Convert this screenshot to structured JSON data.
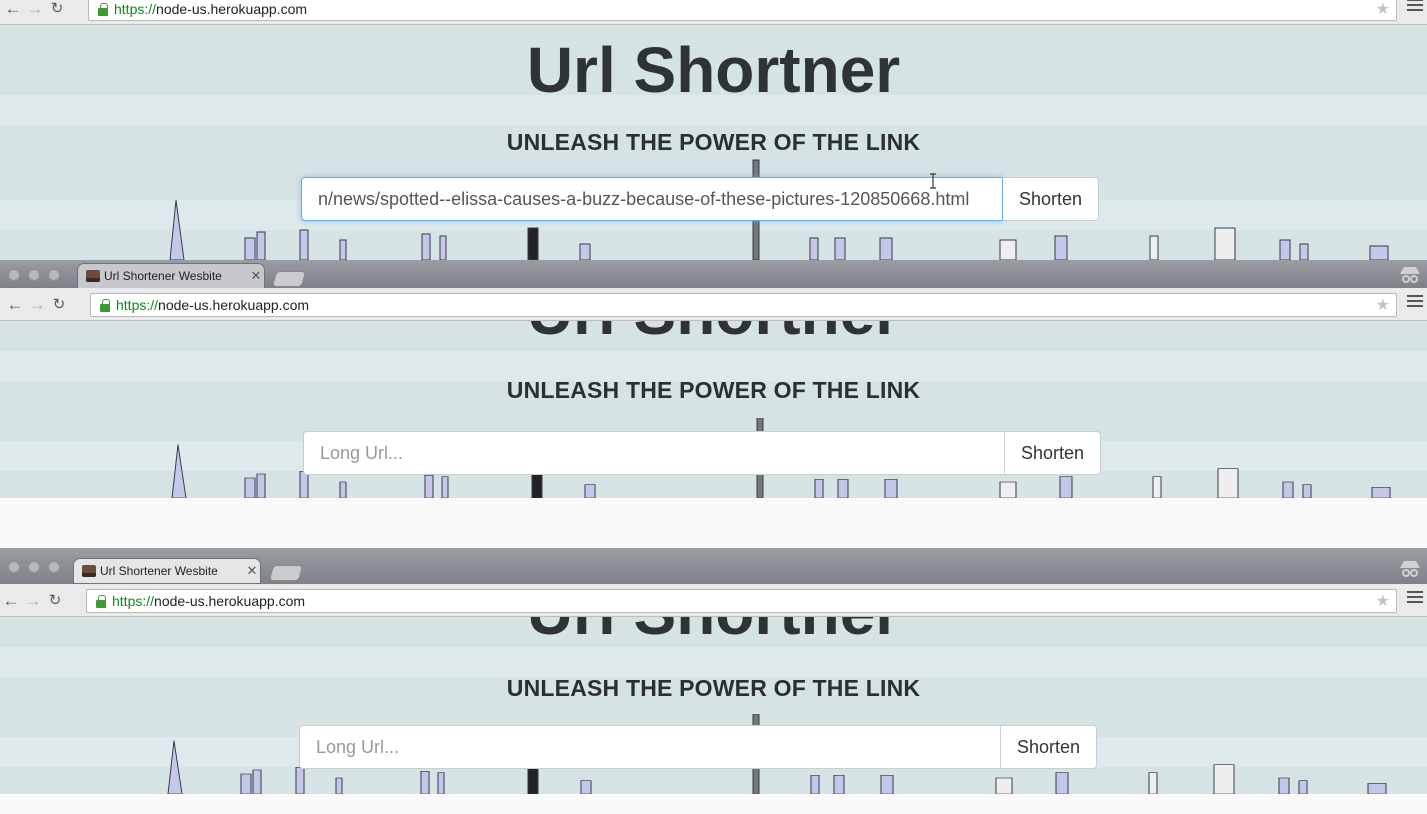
{
  "windows": [
    {
      "id": "top",
      "show_tabbar": false,
      "url_scheme": "https://",
      "url_host": "node-us.herokuapp.com",
      "title": "Url Shortner",
      "subtitle": "UNLEASH THE POWER OF THE LINK",
      "input_value": "n/news/spotted--elissa-causes-a-buzz-because-of-these-pictures-120850668.html",
      "button_label": "Shorten"
    },
    {
      "id": "middle",
      "show_tabbar": true,
      "tab_title": "Url Shortener Wesbite",
      "url_scheme": "https://",
      "url_host": "node-us.herokuapp.com",
      "title": "Url Shortner",
      "subtitle": "UNLEASH THE POWER OF THE LINK",
      "input_placeholder": "Long Url...",
      "button_label": "Shorten"
    },
    {
      "id": "bottom",
      "show_tabbar": true,
      "tab_title": "Url Shortener Wesbite",
      "url_scheme": "https://",
      "url_host": "node-us.herokuapp.com",
      "title": "Url Shortner",
      "subtitle": "UNLEASH THE POWER OF THE LINK",
      "input_placeholder": "Long Url...",
      "button_label": "Shorten"
    }
  ],
  "colors": {
    "page_bg": "#d5e3e5",
    "url_scheme": "#0b8a1e",
    "heading": "#2f3333",
    "focus_ring": "#66afe9"
  },
  "icons": [
    "back-arrow-icon",
    "forward-arrow-icon",
    "reload-icon",
    "lock-icon",
    "bookmark-star-icon",
    "hamburger-menu-icon",
    "incognito-icon",
    "favicon-icon",
    "text-cursor-icon"
  ]
}
